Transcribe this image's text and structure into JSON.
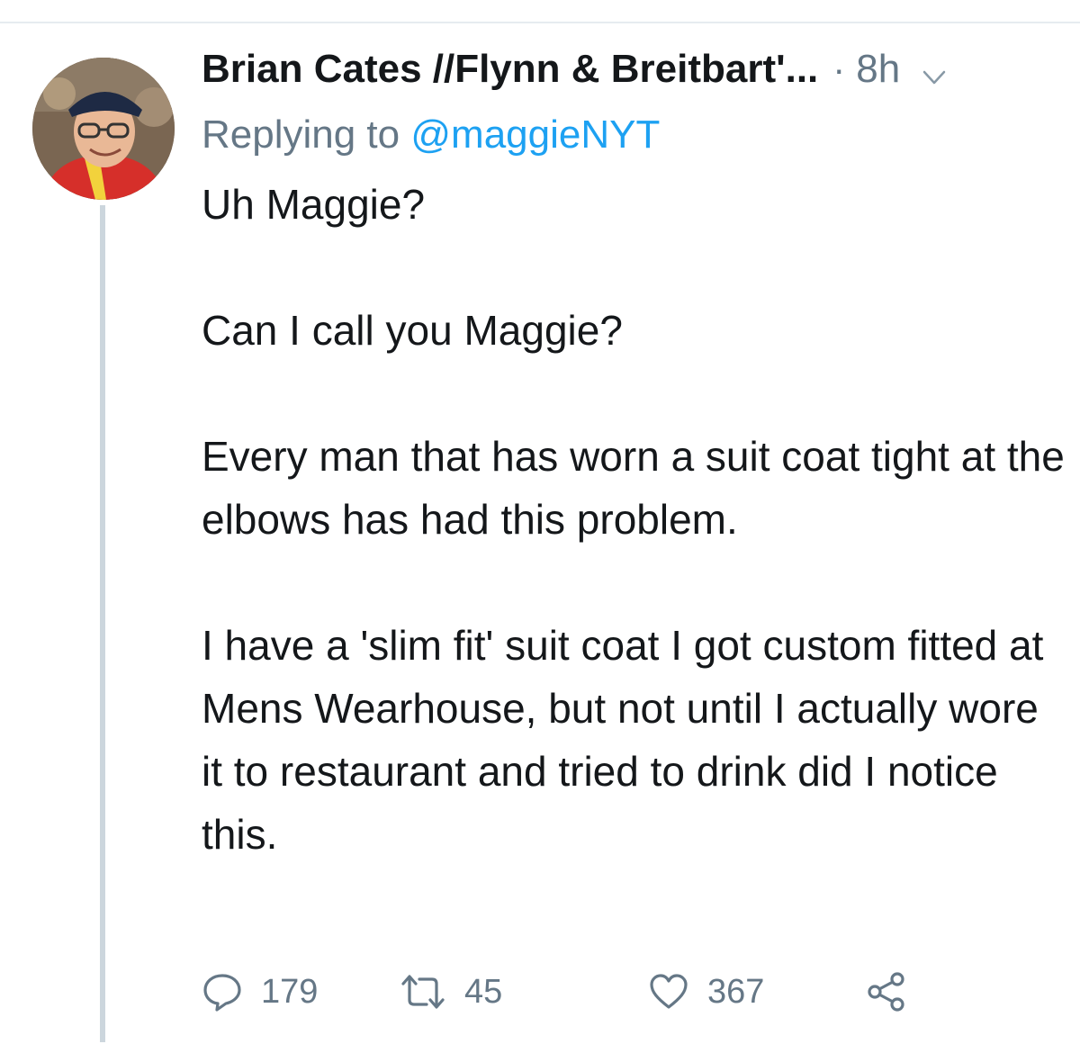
{
  "tweet": {
    "author": {
      "display_name": "Brian Cates //Flynn & Breitbart'...",
      "avatar_icon": "user-avatar"
    },
    "separator": "·",
    "time": "8h",
    "replying": {
      "prefix": "Replying to",
      "handle": "@maggieNYT"
    },
    "body": {
      "p1": "Uh Maggie?",
      "p2": "Can I call you Maggie?",
      "p3": "Every man that has worn a suit coat tight at the elbows has had this problem.",
      "p4": "I have a 'slim fit' suit coat I got custom fitted at Mens Wearhouse, but not until I actually wore it to restaurant and tried to drink did I notice this."
    },
    "actions": {
      "reply_count": "179",
      "retweet_count": "45",
      "like_count": "367"
    }
  },
  "colors": {
    "text_primary": "#14171a",
    "text_secondary": "#657786",
    "link_blue": "#1da1f2",
    "thread_line": "#ccd6dd"
  },
  "icons": {
    "reply": "reply-bubble-icon",
    "retweet": "retweet-icon",
    "like": "heart-icon",
    "share": "share-icon",
    "menu": "chevron-down-icon"
  }
}
